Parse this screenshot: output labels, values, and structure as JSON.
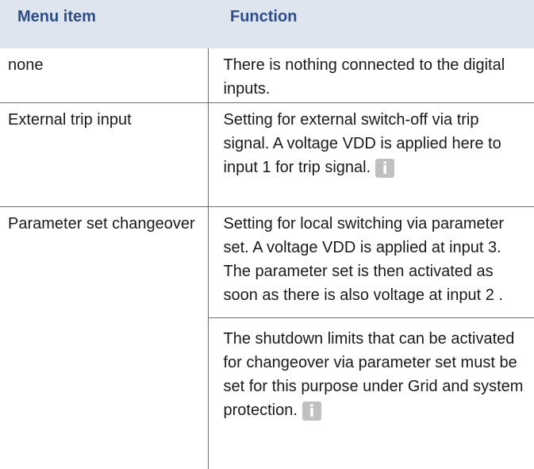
{
  "table": {
    "headers": {
      "menu_item": "Menu item",
      "function": "Function"
    },
    "rows": [
      {
        "menu_item": "none",
        "function": [
          "There is nothing connected to the digital inputs."
        ]
      },
      {
        "menu_item": "External trip input",
        "function": [
          "Setting for external switch-off via trip signal. A voltage VDD is applied here to input 1 for trip signal."
        ],
        "info_icon": "info-icon"
      },
      {
        "menu_item": "Parameter set changeover",
        "function": [
          "Setting for local switching via param­eter set. A voltage VDD is applied at input 3. The parameter set is then activated as soon as there is also voltage at input 2 .",
          "The shutdown limits that can be activated for changeover via parameter set must be set for this purpose under Grid and system protection."
        ],
        "info_icon": "info-icon"
      }
    ]
  },
  "icons": {
    "info": {
      "name": "info-icon",
      "glyph": "i",
      "color": "#c0c0c0"
    }
  },
  "colors": {
    "header_background": "#dfe5ee",
    "header_text": "#2c4d8a",
    "body_text": "#1a1a1a",
    "rule": "#6f6f6f"
  }
}
